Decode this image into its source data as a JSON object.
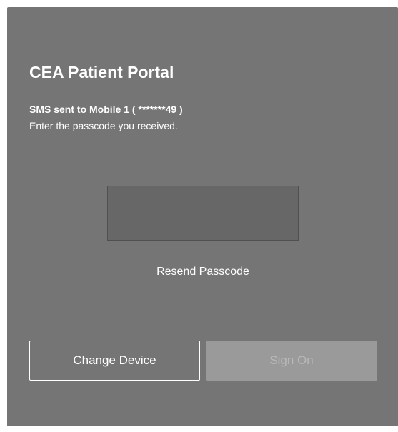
{
  "portal": {
    "title": "CEA Patient Portal",
    "sms_notice": "SMS sent to Mobile 1 ( *******49 )",
    "instruction": "Enter the passcode you received.",
    "passcode_value": "",
    "resend_label": "Resend Passcode",
    "change_device_label": "Change Device",
    "sign_on_label": "Sign On"
  },
  "colors": {
    "panel_background": "#757575",
    "input_background": "#676767",
    "disabled_button": "#9a9a9a",
    "text": "#ffffff"
  }
}
